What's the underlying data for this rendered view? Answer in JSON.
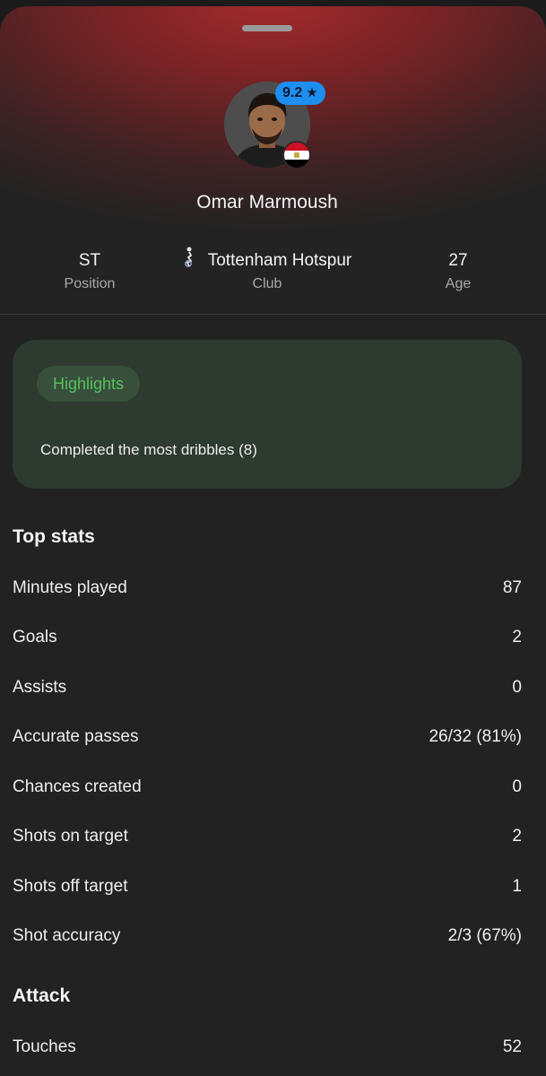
{
  "player": {
    "name": "Omar Marmoush",
    "rating": "9.2",
    "rating_icon": "star-icon",
    "country_flag_colors": [
      "#ce1126",
      "#ffffff",
      "#000000"
    ]
  },
  "info": {
    "position": {
      "value": "ST",
      "label": "Position"
    },
    "club": {
      "value": "Tottenham Hotspur",
      "label": "Club",
      "icon": "club-crest-icon"
    },
    "age": {
      "value": "27",
      "label": "Age"
    }
  },
  "highlights": {
    "title": "Highlights",
    "items": [
      "Completed the most dribbles (8)"
    ]
  },
  "top_stats": {
    "title": "Top stats",
    "rows": [
      {
        "label": "Minutes played",
        "value": "87"
      },
      {
        "label": "Goals",
        "value": "2"
      },
      {
        "label": "Assists",
        "value": "0"
      },
      {
        "label": "Accurate passes",
        "value": "26/32 (81%)"
      },
      {
        "label": "Chances created",
        "value": "0"
      },
      {
        "label": "Shots on target",
        "value": "2"
      },
      {
        "label": "Shots off target",
        "value": "1"
      },
      {
        "label": "Shot accuracy",
        "value": "2/3 (67%)"
      }
    ]
  },
  "attack": {
    "title": "Attack",
    "rows": [
      {
        "label": "Touches",
        "value": "52"
      }
    ]
  },
  "colors": {
    "rating_badge": "#1f8ef1",
    "highlight_bg": "#2d3a2f",
    "highlight_accent": "#56c05f",
    "header_red": "#a42a2d"
  }
}
